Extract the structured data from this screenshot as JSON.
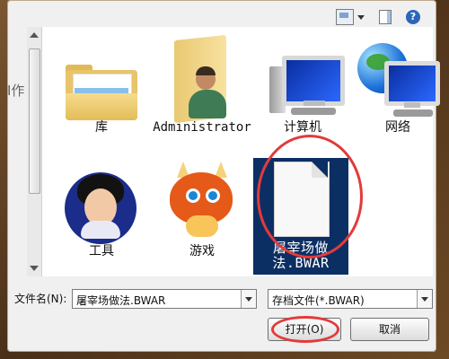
{
  "toolbar": {
    "icons": [
      "view-icon",
      "view-dropdown-icon",
      "preview-pane-icon",
      "help-icon"
    ],
    "help_glyph": "?"
  },
  "left_partial_text": "Ⅰ作",
  "items": [
    {
      "label": "库",
      "icon": "library-folder-icon"
    },
    {
      "label": "Administrator",
      "icon": "user-folder-icon"
    },
    {
      "label": "计算机",
      "icon": "computer-icon"
    },
    {
      "label": "网络",
      "icon": "network-icon"
    },
    {
      "label": "工具",
      "icon": "tools-avatar-icon"
    },
    {
      "label": "游戏",
      "icon": "game-dragon-icon"
    },
    {
      "label": "屠宰场做法.BWAR",
      "icon": "file-icon",
      "selected": true
    }
  ],
  "filename": {
    "label": "文件名(N):",
    "value": "屠宰场做法.BWAR"
  },
  "filetype": {
    "value": "存档文件(*.BWAR)"
  },
  "buttons": {
    "open": "打开(O)",
    "cancel": "取消"
  },
  "colors": {
    "selection": "#0c2f63",
    "annotation": "#e23b3b"
  }
}
